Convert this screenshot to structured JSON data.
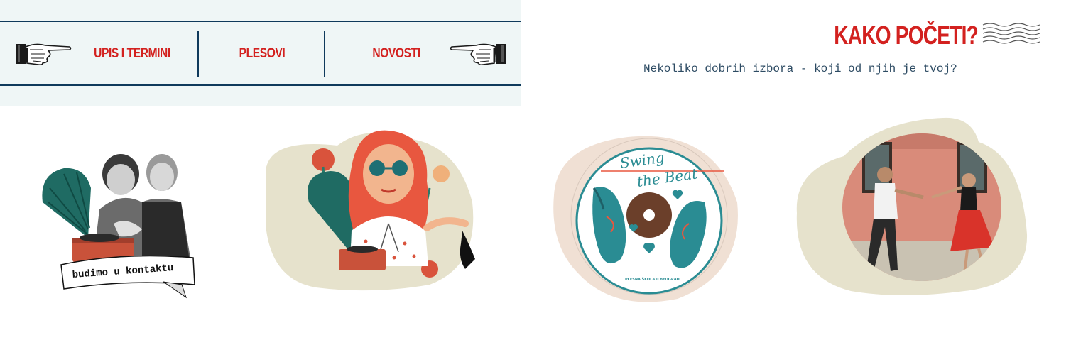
{
  "nav": {
    "items": [
      {
        "label": "UPIS I TERMINI"
      },
      {
        "label": "PLESOVI"
      },
      {
        "label": "NOVOSTI"
      }
    ]
  },
  "section": {
    "heading": "KAKO POČETI?",
    "subtitle": "Nekoliko dobrih izbora - koji od njih je tvoj?"
  },
  "cards": {
    "contact": {
      "ribbon": "budimo u kontaktu"
    },
    "logo": {
      "title_line1": "Swing",
      "title_line2": "the Beat",
      "school": "PLESNA ŠKOLA u BEOGRAD"
    }
  },
  "colors": {
    "accent_red": "#d3211f",
    "navy": "#0f3a5c",
    "nav_bg": "#eff6f6",
    "blob_beige": "#e6e2cc",
    "blob_peach": "#f0e0d4",
    "teal": "#2a8c93"
  },
  "icons": [
    "pointing-hand-left-icon",
    "pointing-hand-right-icon",
    "postmark-icon"
  ]
}
